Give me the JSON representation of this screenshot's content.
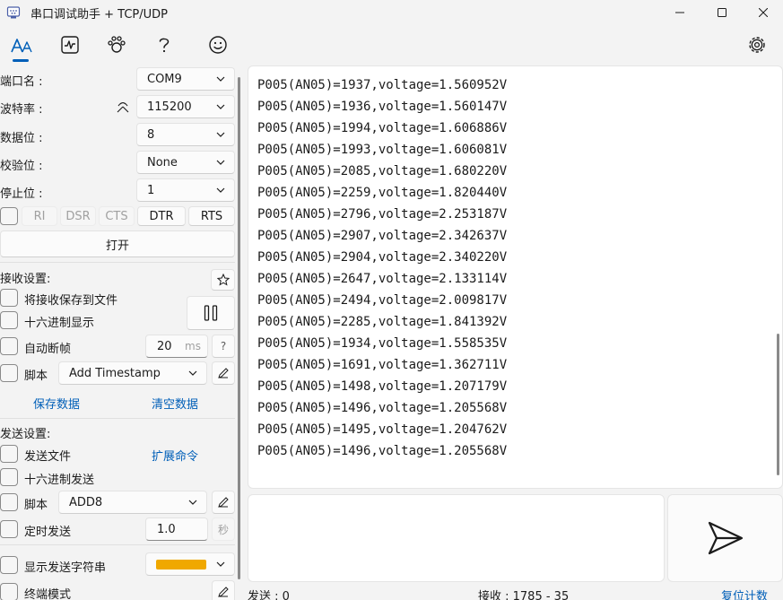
{
  "window": {
    "title": "串口调试助手 + TCP/UDP"
  },
  "port_settings": {
    "port_label": "端口名 :",
    "port_value": "COM9",
    "baud_label": "波特率 :",
    "baud_value": "115200",
    "data_bits_label": "数据位 :",
    "data_bits_value": "8",
    "parity_label": "校验位 :",
    "parity_value": "None",
    "stop_bits_label": "停止位 :",
    "stop_bits_value": "1",
    "signals": [
      "RI",
      "DSR",
      "CTS",
      "DTR",
      "RTS"
    ],
    "open_label": "打开"
  },
  "receive_settings": {
    "title": "接收设置:",
    "save_to_file_label": "将接收保存到文件",
    "hex_display_label": "十六进制显示",
    "auto_frame_label": "自动断帧",
    "auto_frame_value": "20",
    "auto_frame_unit": "ms",
    "help_label": "?",
    "script_label": "脚本",
    "script_value": "Add Timestamp",
    "save_data_label": "保存数据",
    "clear_data_label": "清空数据"
  },
  "send_settings": {
    "title": "发送设置:",
    "send_file_label": "发送文件",
    "extend_cmd_label": "扩展命令",
    "hex_send_label": "十六进制发送",
    "script_label": "脚本",
    "script_value": "ADD8",
    "timed_send_label": "定时发送",
    "timed_send_value": "1.0",
    "timed_send_unit": "秒",
    "show_send_string_label": "显示发送字符串",
    "send_string_color": "#f0a800",
    "terminal_mode_label": "终端模式"
  },
  "receive_log": [
    "P005(AN05)=1937,voltage=1.560952V",
    "P005(AN05)=1936,voltage=1.560147V",
    "P005(AN05)=1994,voltage=1.606886V",
    "P005(AN05)=1993,voltage=1.606081V",
    "P005(AN05)=2085,voltage=1.680220V",
    "P005(AN05)=2259,voltage=1.820440V",
    "P005(AN05)=2796,voltage=2.253187V",
    "P005(AN05)=2907,voltage=2.342637V",
    "P005(AN05)=2904,voltage=2.340220V",
    "P005(AN05)=2647,voltage=2.133114V",
    "P005(AN05)=2494,voltage=2.009817V",
    "P005(AN05)=2285,voltage=1.841392V",
    "P005(AN05)=1934,voltage=1.558535V",
    "P005(AN05)=1691,voltage=1.362711V",
    "P005(AN05)=1498,voltage=1.207179V",
    "P005(AN05)=1496,voltage=1.205568V",
    "P005(AN05)=1495,voltage=1.204762V",
    "P005(AN05)=1496,voltage=1.205568V"
  ],
  "status_bar": {
    "send_label": "发送 : 0",
    "receive_label": "接收 : 1785 - 35",
    "reset_label": "复位计数"
  },
  "colors": {
    "accent": "#005fb8",
    "background": "#f3f3f3"
  }
}
